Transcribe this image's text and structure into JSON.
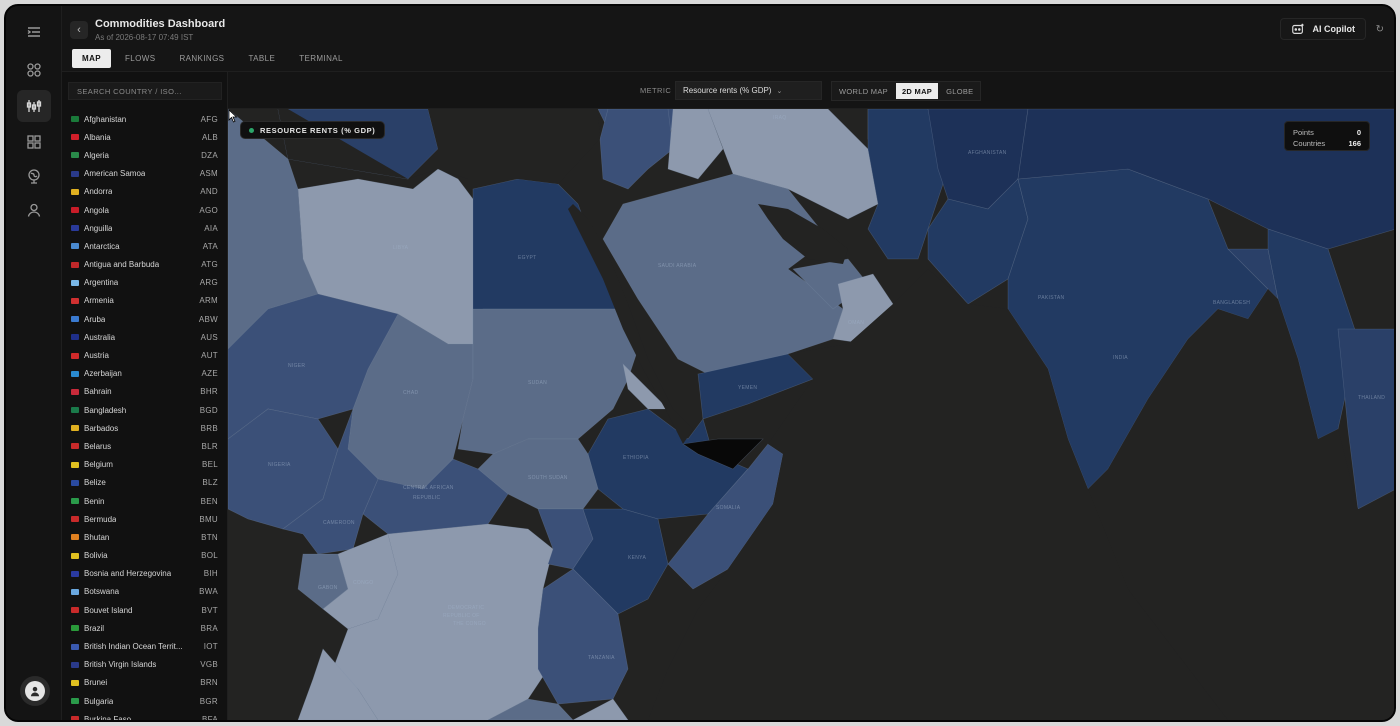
{
  "header": {
    "title": "Commodities Dashboard",
    "subtitle": "As of 2026-08-17 07:49 IST",
    "tabs": [
      {
        "label": "MAP",
        "active": true
      },
      {
        "label": "FLOWS",
        "active": false
      },
      {
        "label": "RANKINGS",
        "active": false
      },
      {
        "label": "TABLE",
        "active": false
      },
      {
        "label": "TERMINAL",
        "active": false
      }
    ],
    "copilot_label": "AI Copilot"
  },
  "sidebar": {
    "search_placeholder": "SEARCH COUNTRY / ISO...",
    "countries": [
      {
        "name": "Afghanistan",
        "iso": "AFG",
        "flag": "#1a7a3a"
      },
      {
        "name": "Albania",
        "iso": "ALB",
        "flag": "#d11f2a"
      },
      {
        "name": "Algeria",
        "iso": "DZA",
        "flag": "#2a8a4a"
      },
      {
        "name": "American Samoa",
        "iso": "ASM",
        "flag": "#2a3a8a"
      },
      {
        "name": "Andorra",
        "iso": "AND",
        "flag": "#e0b020"
      },
      {
        "name": "Angola",
        "iso": "AGO",
        "flag": "#c81c28"
      },
      {
        "name": "Anguilla",
        "iso": "AIA",
        "flag": "#2a3a9a"
      },
      {
        "name": "Antarctica",
        "iso": "ATA",
        "flag": "#4a8ad0"
      },
      {
        "name": "Antigua and Barbuda",
        "iso": "ATG",
        "flag": "#c0282a"
      },
      {
        "name": "Argentina",
        "iso": "ARG",
        "flag": "#7ab8e8"
      },
      {
        "name": "Armenia",
        "iso": "ARM",
        "flag": "#d03030"
      },
      {
        "name": "Aruba",
        "iso": "ABW",
        "flag": "#3a7ad0"
      },
      {
        "name": "Australia",
        "iso": "AUS",
        "flag": "#1f2f8a"
      },
      {
        "name": "Austria",
        "iso": "AUT",
        "flag": "#d02a2a"
      },
      {
        "name": "Azerbaijan",
        "iso": "AZE",
        "flag": "#2a8ad0"
      },
      {
        "name": "Bahrain",
        "iso": "BHR",
        "flag": "#c82a3a"
      },
      {
        "name": "Bangladesh",
        "iso": "BGD",
        "flag": "#1a7a4a"
      },
      {
        "name": "Barbados",
        "iso": "BRB",
        "flag": "#e0b020"
      },
      {
        "name": "Belarus",
        "iso": "BLR",
        "flag": "#c82a2a"
      },
      {
        "name": "Belgium",
        "iso": "BEL",
        "flag": "#e0c020"
      },
      {
        "name": "Belize",
        "iso": "BLZ",
        "flag": "#2a4aa0"
      },
      {
        "name": "Benin",
        "iso": "BEN",
        "flag": "#2a9a4a"
      },
      {
        "name": "Bermuda",
        "iso": "BMU",
        "flag": "#c82a2a"
      },
      {
        "name": "Bhutan",
        "iso": "BTN",
        "flag": "#e08020"
      },
      {
        "name": "Bolivia",
        "iso": "BOL",
        "flag": "#e0c020"
      },
      {
        "name": "Bosnia and Herzegovina",
        "iso": "BIH",
        "flag": "#2a3aa0"
      },
      {
        "name": "Botswana",
        "iso": "BWA",
        "flag": "#6aa8e0"
      },
      {
        "name": "Bouvet Island",
        "iso": "BVT",
        "flag": "#c82a2a"
      },
      {
        "name": "Brazil",
        "iso": "BRA",
        "flag": "#2a9a3a"
      },
      {
        "name": "British Indian Ocean Territ...",
        "iso": "IOT",
        "flag": "#3a5ab0"
      },
      {
        "name": "British Virgin Islands",
        "iso": "VGB",
        "flag": "#2a3a8a"
      },
      {
        "name": "Brunei",
        "iso": "BRN",
        "flag": "#e0c020"
      },
      {
        "name": "Bulgaria",
        "iso": "BGR",
        "flag": "#2a9a4a"
      },
      {
        "name": "Burkina Faso",
        "iso": "BFA",
        "flag": "#c82a2a"
      }
    ]
  },
  "map": {
    "metric_label": "METRIC",
    "metric_value": "Resource rents (% GDP)",
    "views": [
      {
        "label": "WORLD MAP",
        "active": false
      },
      {
        "label": "2D MAP",
        "active": true
      },
      {
        "label": "GLOBE",
        "active": false
      }
    ],
    "legend_chip": "RESOURCE RENTS (% GDP)",
    "stats": {
      "points_label": "Points",
      "points_value": "0",
      "countries_label": "Countries",
      "countries_value": "166"
    },
    "colors": {
      "water": "#232322",
      "light": "#8d99ad",
      "mid": "#5b6c88",
      "darkmid": "#3b4f72",
      "dark": "#223a62",
      "deep": "#1d3158"
    }
  }
}
